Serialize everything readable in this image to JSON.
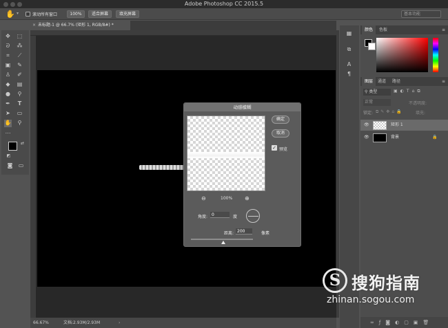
{
  "app": {
    "title": "Adobe Photoshop CC 2015.5"
  },
  "options_bar": {
    "scroll_all_windows": "滚动所有窗口",
    "zoom_100": "100%",
    "fit_screen": "适合屏幕",
    "fill_screen": "填充屏幕",
    "workspace": "基本功能"
  },
  "document": {
    "tab_title": "未标题-1 @ 66.7% (矩形 1, RGB/8#) *"
  },
  "status": {
    "zoom": "66.67%",
    "doc_size": "文档:2.93M/2.93M"
  },
  "dialog": {
    "title": "动感模糊",
    "ok": "确定",
    "cancel": "取消",
    "preview": "预览",
    "preview_checked": true,
    "preview_zoom": "100%",
    "angle_label": "角度:",
    "angle_value": "0",
    "angle_unit": "度",
    "distance_label": "距离:",
    "distance_value": "200",
    "distance_unit": "像素"
  },
  "panels": {
    "color_tabs": [
      "颜色",
      "色板"
    ],
    "layers_tabs": [
      "图层",
      "通道",
      "路径"
    ],
    "kind_filter": "类型",
    "blend_mode": "正常",
    "opacity_label": "不透明度:",
    "lock_label": "锁定:",
    "fill_label": "填充:",
    "layers": [
      {
        "name": "矩形 1",
        "selected": true
      },
      {
        "name": "背景",
        "selected": false
      }
    ]
  },
  "watermark": {
    "name": "搜狗指南",
    "url": "zhinan.sogou.com",
    "logo_letter": "S"
  }
}
